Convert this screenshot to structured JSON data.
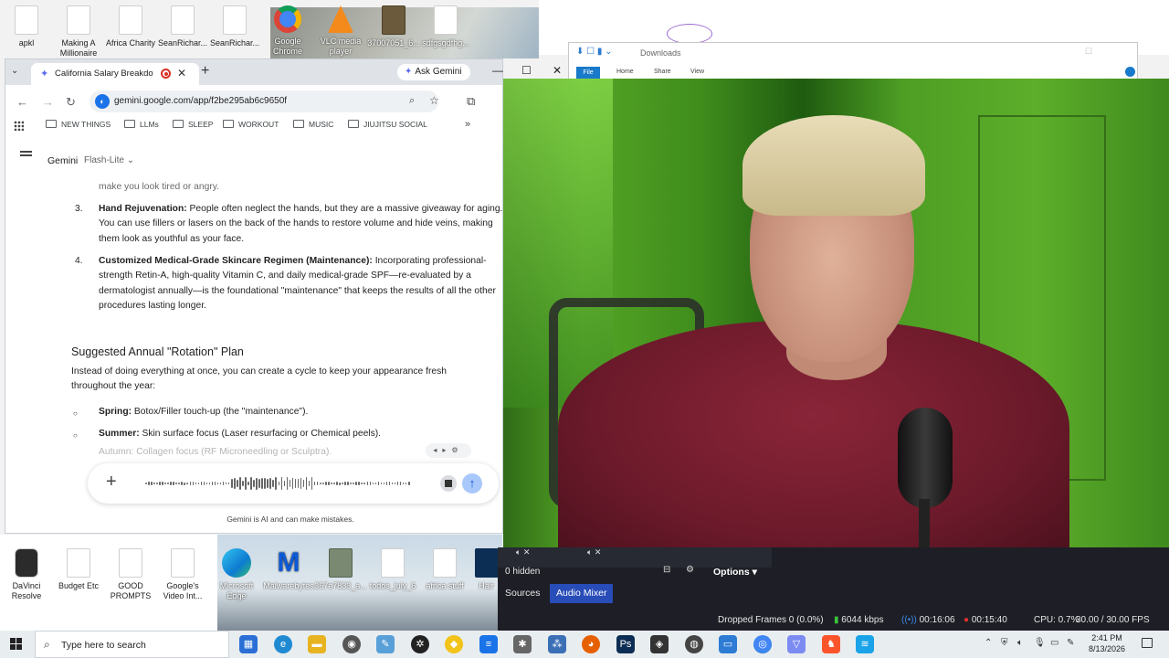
{
  "desktop": {
    "top_icons": [
      {
        "label": "apkl"
      },
      {
        "label": "Making A Millionaire"
      },
      {
        "label": "Africa Charity"
      },
      {
        "label": "SeanRichar..."
      },
      {
        "label": "SeanRichar..."
      },
      {
        "label": "Google Chrome"
      },
      {
        "label": "VLC media player"
      },
      {
        "label": "37007051_6..."
      },
      {
        "label": "sdfgsgdfhg..."
      }
    ],
    "bottom_icons": [
      {
        "label": "DaVinci Resolve"
      },
      {
        "label": "Budget Etc"
      },
      {
        "label": "GOOD PROMPTS"
      },
      {
        "label": "Google's Video Int..."
      },
      {
        "label": "Microsoft Edge"
      },
      {
        "label": "Malwarebytes"
      },
      {
        "label": "367e7833_a..."
      },
      {
        "label": "todos_july_6"
      },
      {
        "label": "africa stuff"
      },
      {
        "label": "Hair"
      }
    ]
  },
  "browser": {
    "tab_title": "California Salary Breakdown",
    "ask_gemini": "Ask Gemini",
    "url": "gemini.google.com/app/f2be295ab6c9650f",
    "bookmarks": [
      "NEW THINGS",
      "LLMs",
      "SLEEP",
      "WORKOUT",
      "MUSIC",
      "JIUJITSU SOCIAL"
    ],
    "bookmarks_more": "»",
    "gemini_name": "Gemini",
    "gemini_model": "Flash-Lite",
    "chat": {
      "faded_top": "make you look tired or angry.",
      "items": [
        {
          "num": "3.",
          "title": "Hand Rejuvenation:",
          "text": " People often neglect the hands, but they are a massive giveaway for aging. You can use fillers or lasers on the back of the hands to restore volume and hide veins, making them look as youthful as your face."
        },
        {
          "num": "4.",
          "title": "Customized Medical-Grade Skincare Regimen (Maintenance):",
          "text": " Incorporating professional-strength Retin-A, high-quality Vitamin C, and daily medical-grade SPF—re-evaluated by a dermatologist annually—is the foundational \"maintenance\" that keeps the results of all the other procedures lasting longer."
        }
      ],
      "section_heading": "Suggested Annual \"Rotation\" Plan",
      "section_intro": "Instead of doing everything at once, you can create a cycle to keep your appearance fresh throughout the year:",
      "bullets": [
        {
          "title": "Spring:",
          "text": " Botox/Filler touch-up (the \"maintenance\")."
        },
        {
          "title": "Summer:",
          "text": " Skin surface focus (Laser resurfacing or Chemical peels)."
        }
      ],
      "faded_bottom": "Autumn: Collagen focus (RF Microneedling or Sculptra)."
    },
    "disclaimer": "Gemini is AI and can make mistakes."
  },
  "explorer": {
    "title": "Downloads",
    "ribbon": [
      "File",
      "Home",
      "Share",
      "View"
    ]
  },
  "obs": {
    "hidden_label": "0 hidden",
    "options_label": "Options",
    "tabs": [
      "Sources",
      "Audio Mixer"
    ],
    "active_tab": "Audio Mixer",
    "status": {
      "dropped": "Dropped Frames 0 (0.0%)",
      "bitrate": "6044 kbps",
      "stream_time": "00:16:06",
      "rec_time": "00:15:40",
      "cpu": "CPU: 0.7%",
      "fps": "30.00 / 30.00 FPS"
    }
  },
  "taskbar": {
    "search_placeholder": "Type here to search",
    "time": "2:41 PM",
    "date": "8/13/2026"
  },
  "colors": {
    "obs_active_tab": "#284cb8",
    "gemini_accent": "#5a6cf0",
    "record_red": "#e53030"
  }
}
